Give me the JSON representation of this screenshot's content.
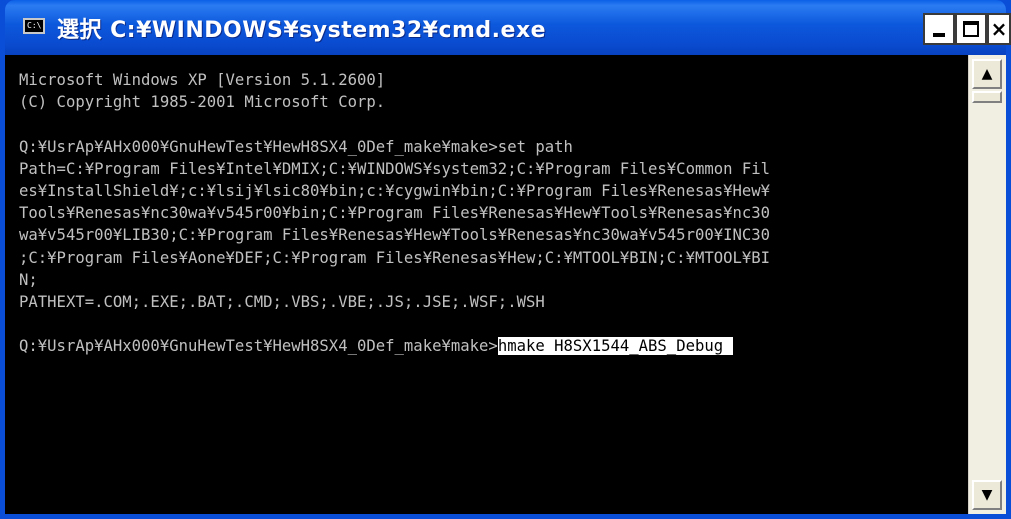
{
  "window": {
    "title": "選択 C:¥WINDOWS¥system32¥cmd.exe",
    "icon_text": "C:\\",
    "close_label": "×"
  },
  "console": {
    "lines": [
      "Microsoft Windows XP [Version 5.1.2600]",
      "(C) Copyright 1985-2001 Microsoft Corp.",
      "",
      "Q:¥UsrAp¥AHx000¥GnuHewTest¥HewH8SX4_0Def_make¥make>set path",
      "Path=C:¥Program Files¥Intel¥DMIX;C:¥WINDOWS¥system32;C:¥Program Files¥Common Fil",
      "es¥InstallShield¥;c:¥lsij¥lsic80¥bin;c:¥cygwin¥bin;C:¥Program Files¥Renesas¥Hew¥",
      "Tools¥Renesas¥nc30wa¥v545r00¥bin;C:¥Program Files¥Renesas¥Hew¥Tools¥Renesas¥nc30",
      "wa¥v545r00¥LIB30;C:¥Program Files¥Renesas¥Hew¥Tools¥Renesas¥nc30wa¥v545r00¥INC30",
      ";C:¥Program Files¥Aone¥DEF;C:¥Program Files¥Renesas¥Hew;C:¥MTOOL¥BIN;C:¥MTOOL¥BI",
      "N;",
      "PATHEXT=.COM;.EXE;.BAT;.CMD;.VBS;.VBE;.JS;.JSE;.WSF;.WSH",
      ""
    ],
    "prompt": "Q:¥UsrAp¥AHx000¥GnuHewTest¥HewH8SX4_0Def_make¥make>",
    "selected_command": "hmake H8SX1544_ABS_Debug "
  },
  "scrollbar": {
    "up_glyph": "▲",
    "down_glyph": "▼"
  },
  "colors": {
    "titlebar": "#0a4ed8",
    "console_bg": "#000000",
    "console_fg": "#c0c0c0",
    "selection_bg": "#ffffff"
  }
}
